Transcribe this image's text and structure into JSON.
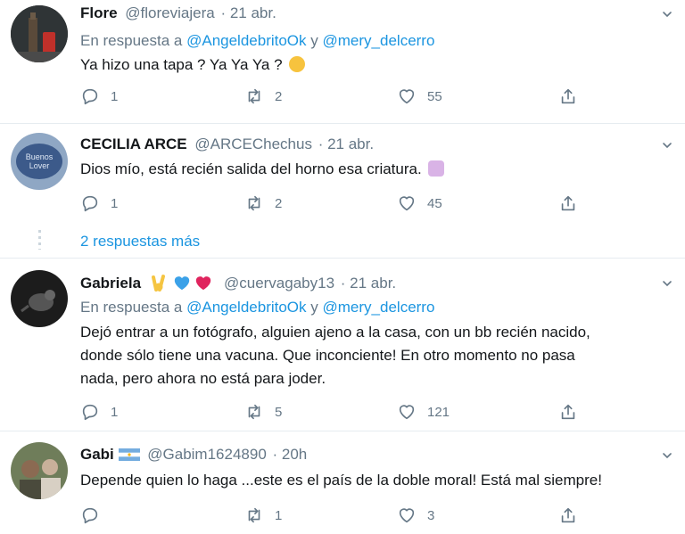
{
  "tweets": [
    {
      "name": "Flore",
      "handle": "@floreviajera",
      "date": "· 21 abr.",
      "reply_prefix": "En respuesta a",
      "mention1": "@AngeldebritoOk",
      "reply_join": "y",
      "mention2": "@mery_delcerro",
      "text": "Ya hizo una tapa ? Ya Ya Ya ?",
      "replies": "1",
      "retweets": "2",
      "likes": "55"
    },
    {
      "name": "CECILIA ARCE",
      "handle": "@ARCEChechus",
      "date": "· 21 abr.",
      "text": "Dios mío, está recién salida del horno esa criatura.",
      "replies": "1",
      "retweets": "2",
      "likes": "45"
    },
    {
      "name": "Gabriela",
      "handle": "@cuervagaby13",
      "date": "· 21 abr.",
      "reply_prefix": "En respuesta a",
      "mention1": "@AngeldebritoOk",
      "reply_join": "y",
      "mention2": "@mery_delcerro",
      "text_line1": "Dejó entrar a un fotógrafo, alguien ajeno a la casa, con un bb recién nacido,",
      "text_line2": "donde sólo tiene una vacuna. Que inconciente! En otro momento no pasa",
      "text_line3": "nada, pero ahora no está para joder.",
      "replies": "1",
      "retweets": "5",
      "likes": "121"
    },
    {
      "name": "Gabi",
      "handle": "@Gabim1624890",
      "date": "· 20h",
      "text": "Depende quien lo haga ...este es el país de la doble moral! Está mal siempre!",
      "replies": "",
      "retweets": "1",
      "likes": "3"
    }
  ],
  "more_replies": "2 respuestas más",
  "icons": {
    "reply": "reply-icon",
    "retweet": "retweet-icon",
    "like": "heart-icon",
    "share": "share-icon",
    "caret": "chevron-down-icon"
  },
  "colors": {
    "link": "#1b95e0",
    "secondary": "#657786",
    "separator": "#e6ecf0"
  }
}
